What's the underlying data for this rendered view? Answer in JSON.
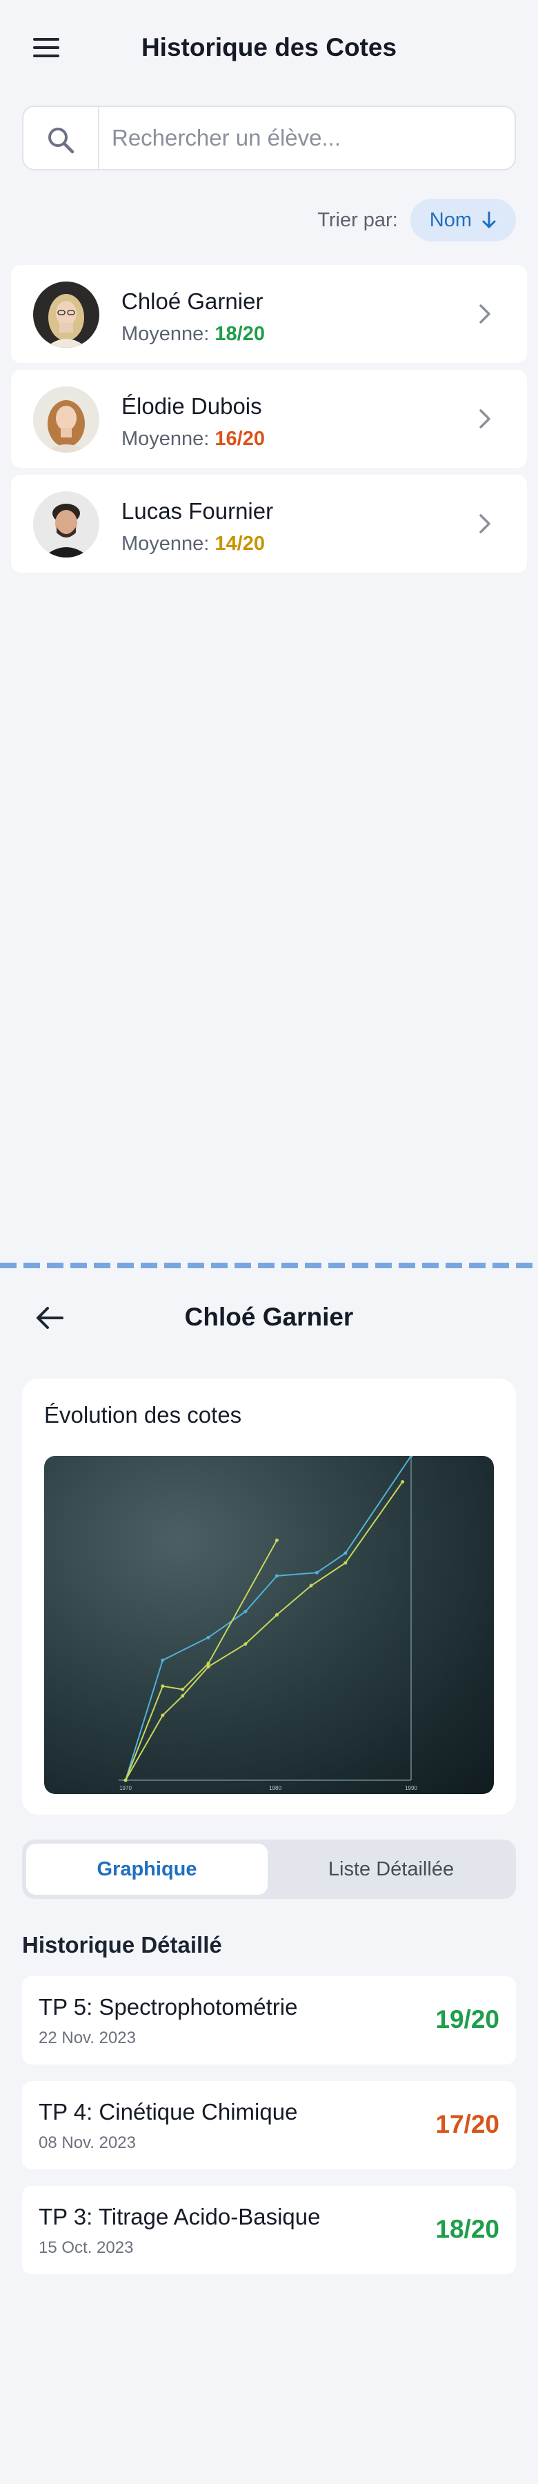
{
  "list_screen": {
    "title": "Historique des Cotes",
    "search": {
      "placeholder": "Rechercher un élève...",
      "value": ""
    },
    "sort": {
      "label": "Trier par:",
      "value": "Nom"
    },
    "students": [
      {
        "name": "Chloé Garnier",
        "avg_label": "Moyenne:",
        "avg": "18/20",
        "avg_color": "#1e9e4a"
      },
      {
        "name": "Élodie Dubois",
        "avg_label": "Moyenne:",
        "avg": "16/20",
        "avg_color": "#d9541a"
      },
      {
        "name": "Lucas Fournier",
        "avg_label": "Moyenne:",
        "avg": "14/20",
        "avg_color": "#c99400"
      }
    ]
  },
  "detail_screen": {
    "title": "Chloé Garnier",
    "chart_card_title": "Évolution des cotes",
    "tabs": {
      "graph": "Graphique",
      "list": "Liste Détaillée"
    },
    "history_title": "Historique Détaillé",
    "entries": [
      {
        "name": "TP 5: Spectrophotométrie",
        "date": "22 Nov. 2023",
        "grade": "19/20",
        "color": "#1e9e4a"
      },
      {
        "name": "TP 4: Cinétique Chimique",
        "date": "08 Nov. 2023",
        "grade": "17/20",
        "color": "#d9541a"
      },
      {
        "name": "TP 3: Titrage Acido-Basique",
        "date": "15 Oct. 2023",
        "grade": "18/20",
        "color": "#1e9e4a"
      }
    ]
  },
  "chart_data": {
    "type": "line",
    "x_ticks": [
      "1970",
      "1980",
      "1990"
    ],
    "ylim": [
      0,
      1
    ],
    "series": [
      {
        "color": "#4fb3d9",
        "x": [
          0,
          0.13,
          0.29,
          0.42,
          0.53,
          0.67,
          0.77,
          1.0
        ],
        "y": [
          0,
          0.37,
          0.44,
          0.52,
          0.63,
          0.64,
          0.7,
          1.0
        ]
      },
      {
        "color": "#c8d65a",
        "x": [
          0,
          0.13,
          0.2,
          0.29,
          0.42,
          0.53,
          0.65,
          0.77,
          0.97
        ],
        "y": [
          0,
          0.2,
          0.26,
          0.35,
          0.42,
          0.51,
          0.6,
          0.67,
          0.92
        ]
      },
      {
        "color": "#c8d65a",
        "x": [
          0,
          0.13,
          0.2,
          0.29,
          0.53
        ],
        "y": [
          0,
          0.29,
          0.28,
          0.36,
          0.74
        ]
      }
    ]
  }
}
